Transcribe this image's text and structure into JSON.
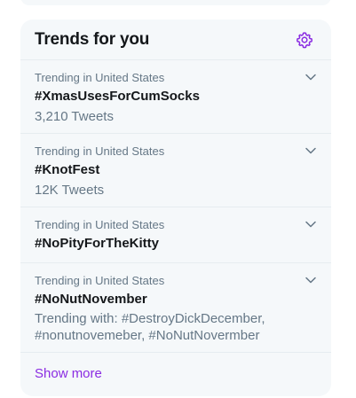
{
  "trends_panel": {
    "title": "Trends for you",
    "accent_color": "#8a2be2",
    "settings_icon": "gear-icon",
    "trends": [
      {
        "context": "Trending in United States",
        "name": "#XmasUsesForCumSocks",
        "meta": "3,210 Tweets"
      },
      {
        "context": "Trending in United States",
        "name": "#KnotFest",
        "meta": "12K Tweets"
      },
      {
        "context": "Trending in United States",
        "name": "#NoPityForTheKitty",
        "meta": ""
      },
      {
        "context": "Trending in United States",
        "name": "#NoNutNovember",
        "meta": "Trending with: #DestroyDickDecember, #nonutnovemeber, #NoNutNovermber"
      }
    ],
    "show_more_label": "Show more"
  }
}
